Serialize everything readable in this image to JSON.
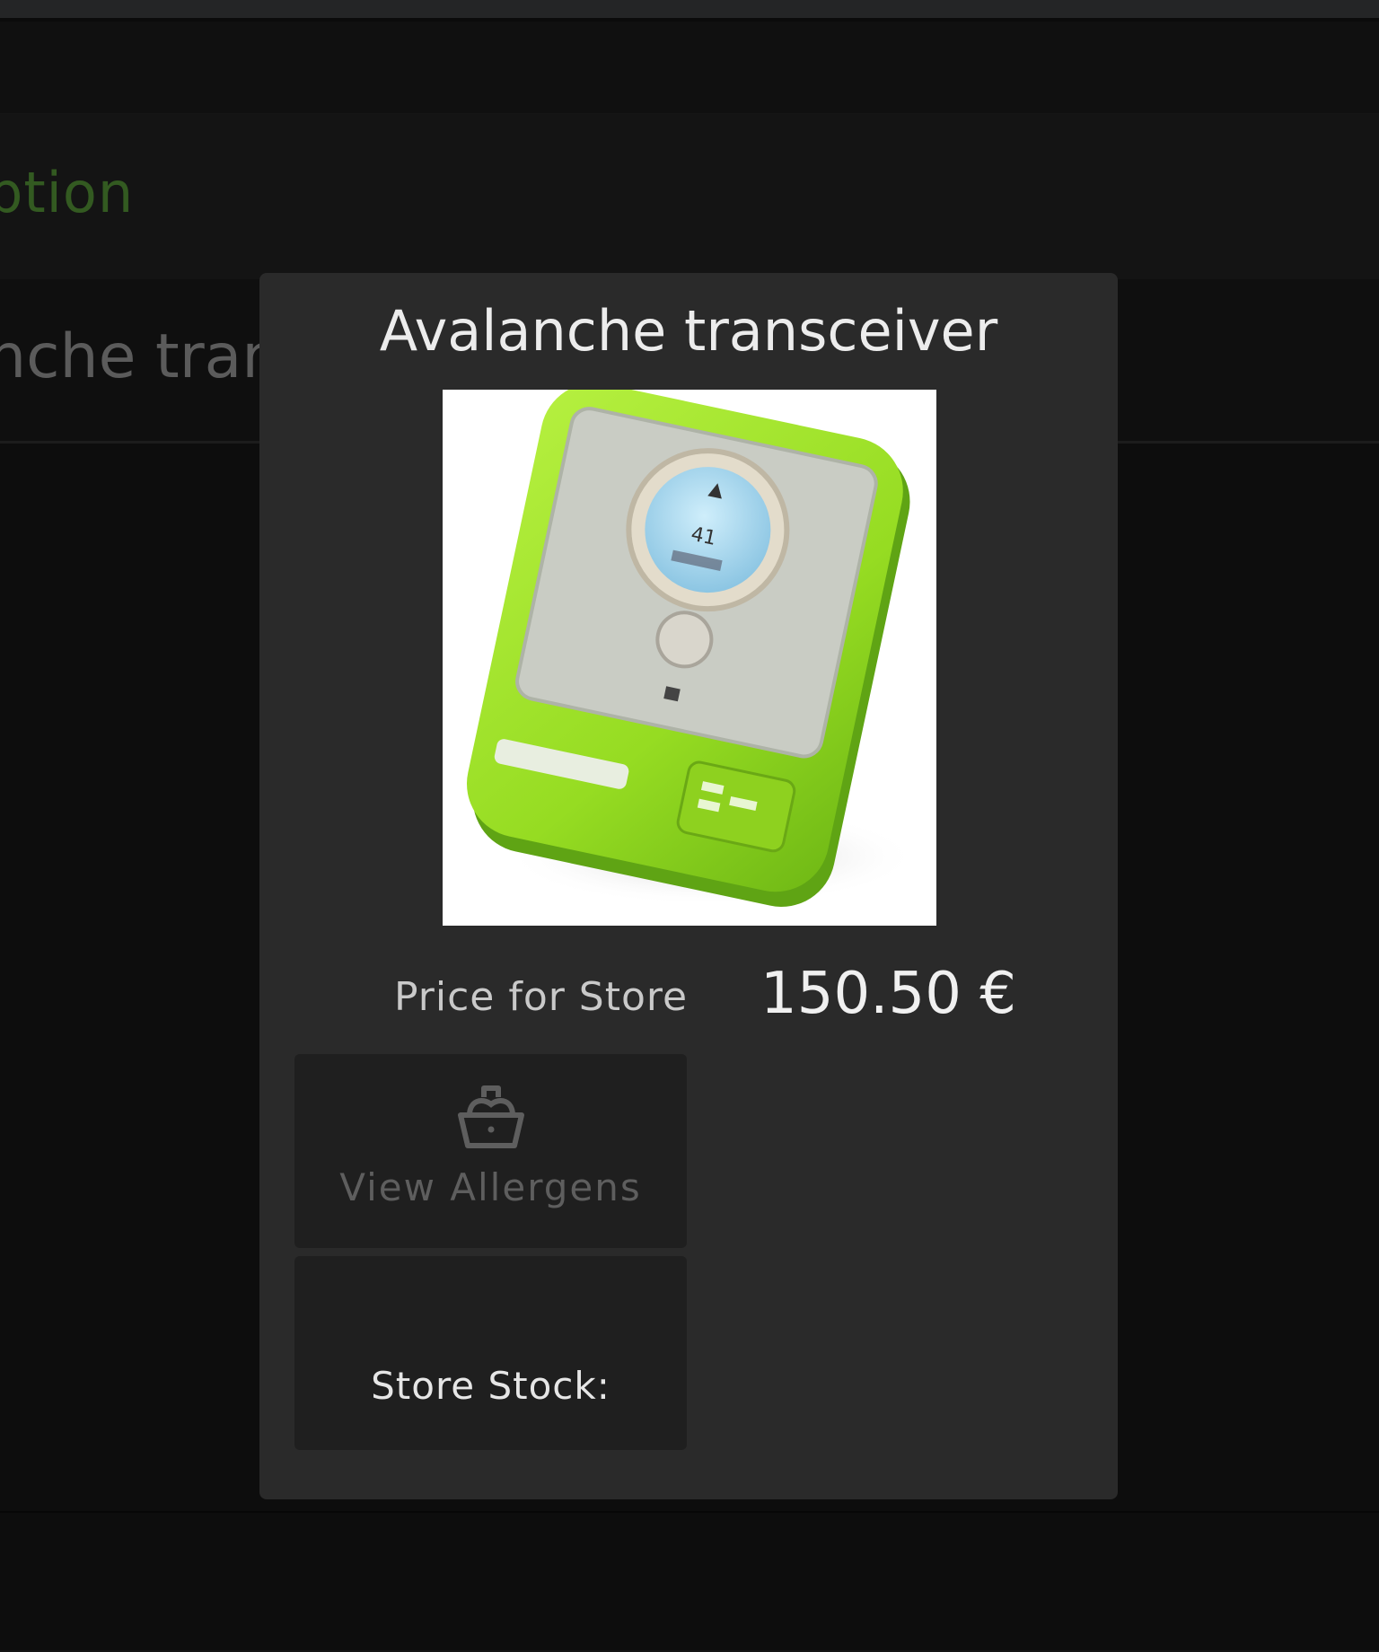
{
  "table": {
    "column_header": "ption",
    "row_text": "nche transc"
  },
  "modal": {
    "title": "Avalanche transceiver",
    "image_icon": "avalanche-transceiver-product-photo",
    "price_label": "Price for Store",
    "price_value": "150.50 €",
    "allergens_button": {
      "label": "View Allergens",
      "icon": "basket-icon"
    },
    "stock_button": {
      "label": "Store Stock:"
    }
  },
  "colors": {
    "accent_green": "#4f8a34",
    "modal_bg": "#2a2a2a",
    "button_bg": "#1f1f1f",
    "device_green": "#9be32a"
  }
}
